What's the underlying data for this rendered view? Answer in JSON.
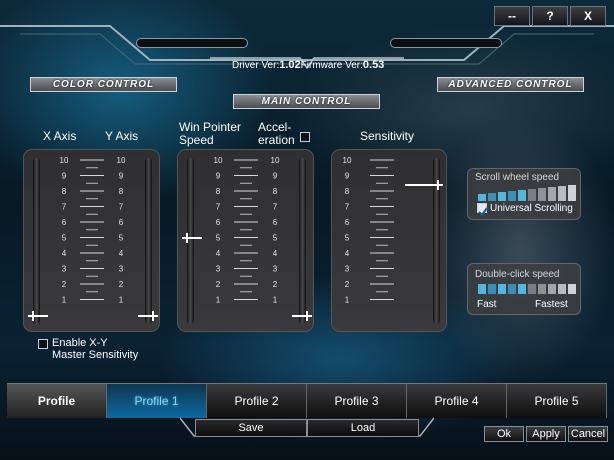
{
  "window": {
    "minimize_label": "--",
    "help_label": "?",
    "close_label": "X"
  },
  "version": {
    "driver_label": "Driver Ver:",
    "driver_value": "1.02",
    "firmware_label": "Firmware Ver:",
    "firmware_value": "0.53"
  },
  "sections": {
    "color_control": "COLOR CONTROL",
    "advanced_control": "ADVANCED CONTROL",
    "main_control": "MAIN CONTROL"
  },
  "columns": {
    "x_axis": "X Axis",
    "y_axis": "Y Axis",
    "win_pointer_line1": "Win Pointer",
    "win_pointer_line2": "Speed",
    "accel_line1": "Accel-",
    "accel_line2": "eration",
    "sensitivity": "Sensitivity"
  },
  "scale": {
    "labels": [
      "10",
      "9",
      "8",
      "7",
      "6",
      "5",
      "4",
      "3",
      "2",
      "1"
    ]
  },
  "sliders": {
    "x_axis_value": 1,
    "y_axis_value": 1,
    "win_pointer_value": 5,
    "acceleration_value": 1,
    "sensitivity_value": 8,
    "acceleration_checked": false
  },
  "enable_xy": {
    "line1": "Enable X-Y",
    "line2": "Master Sensitivity",
    "checked": false
  },
  "scroll_wheel": {
    "title": "Scroll wheel speed",
    "level_fraction": 0.5,
    "universal_label": "Universal Scrolling",
    "universal_checked": true
  },
  "double_click": {
    "title": "Double-click speed",
    "fast_label": "Fast",
    "fastest_label": "Fastest",
    "level_fraction": 0.5
  },
  "tabs": [
    {
      "label": "Profile"
    },
    {
      "label": "Profile 1"
    },
    {
      "label": "Profile 2"
    },
    {
      "label": "Profile 3"
    },
    {
      "label": "Profile 4"
    },
    {
      "label": "Profile 5"
    }
  ],
  "actions": {
    "save": "Save",
    "load": "Load"
  },
  "dialog": {
    "ok": "Ok",
    "apply": "Apply",
    "cancel": "Cancel"
  },
  "colors": {
    "accent": "#3aa6d8",
    "active_tab": "#0d6aa0",
    "panel": "#333335"
  }
}
